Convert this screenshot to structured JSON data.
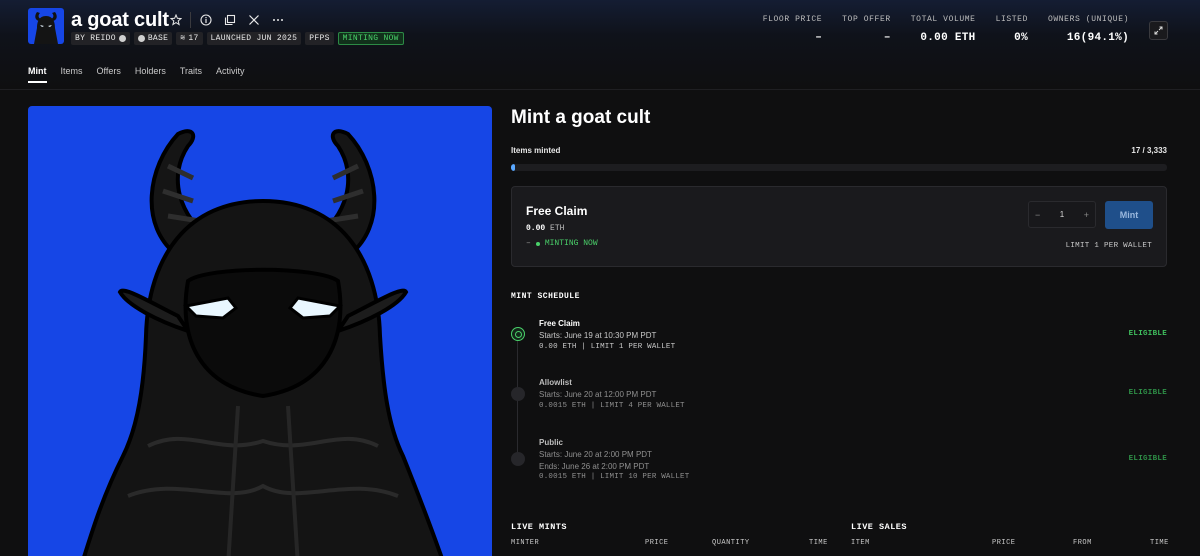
{
  "collection": {
    "name": "a goat cult",
    "badges": {
      "creator": "BY REIDO",
      "chain": "BASE",
      "supply": "17",
      "launched": "LAUNCHED JUN 2025",
      "category": "PFPS",
      "status": "MINTING NOW"
    }
  },
  "stats": [
    {
      "label": "FLOOR PRICE",
      "value": "–"
    },
    {
      "label": "TOP OFFER",
      "value": "–"
    },
    {
      "label": "TOTAL VOLUME",
      "value": "0.00 ETH"
    },
    {
      "label": "LISTED",
      "value": "0%"
    },
    {
      "label": "OWNERS (UNIQUE)",
      "value": "16(94.1%)"
    }
  ],
  "tabs": [
    "Mint",
    "Items",
    "Offers",
    "Holders",
    "Traits",
    "Activity"
  ],
  "mint": {
    "title": "Mint a goat cult",
    "items_label": "Items minted",
    "items_count": "17 / 3,333",
    "progress_fraction": 0.0051,
    "card": {
      "name": "Free Claim",
      "price_value": "0.00",
      "price_unit": "ETH",
      "dash": "–",
      "status": "MINTING NOW",
      "qty_minus": "−",
      "quantity": "1",
      "qty_plus": "+",
      "button": "Mint",
      "limit": "LIMIT 1 PER WALLET"
    }
  },
  "schedule": {
    "heading": "MINT SCHEDULE",
    "phases": [
      {
        "name": "Free Claim",
        "start": "Starts: June 19 at 10:30 PM PDT",
        "end": "",
        "detail": "0.00 ETH | LIMIT 1 PER WALLET",
        "eligibility": "ELIGIBLE"
      },
      {
        "name": "Allowlist",
        "start": "Starts: June 20 at 12:00 PM PDT",
        "end": "",
        "detail": "0.0015 ETH | LIMIT 4 PER WALLET",
        "eligibility": "ELIGIBLE"
      },
      {
        "name": "Public",
        "start": "Starts: June 20 at 2:00 PM PDT",
        "end": "Ends: June 26 at 2:00 PM PDT",
        "detail": "0.0015 ETH | LIMIT 10 PER WALLET",
        "eligibility": "ELIGIBLE"
      }
    ]
  },
  "live_mints": {
    "heading": "LIVE MINTS",
    "columns": [
      "MINTER",
      "PRICE",
      "QUANTITY",
      "TIME"
    ]
  },
  "live_sales": {
    "heading": "LIVE SALES",
    "columns": [
      "ITEM",
      "PRICE",
      "FROM",
      "TIME"
    ]
  },
  "colors": {
    "art_background": "#1646e6",
    "accent_green": "#4ad16a",
    "mint_button": "#1f4f8a",
    "progress": "#5aa8ff"
  },
  "icons": [
    "star-icon",
    "info-icon",
    "copy-icon",
    "x-logo-icon",
    "more-icon",
    "expand-icon"
  ]
}
